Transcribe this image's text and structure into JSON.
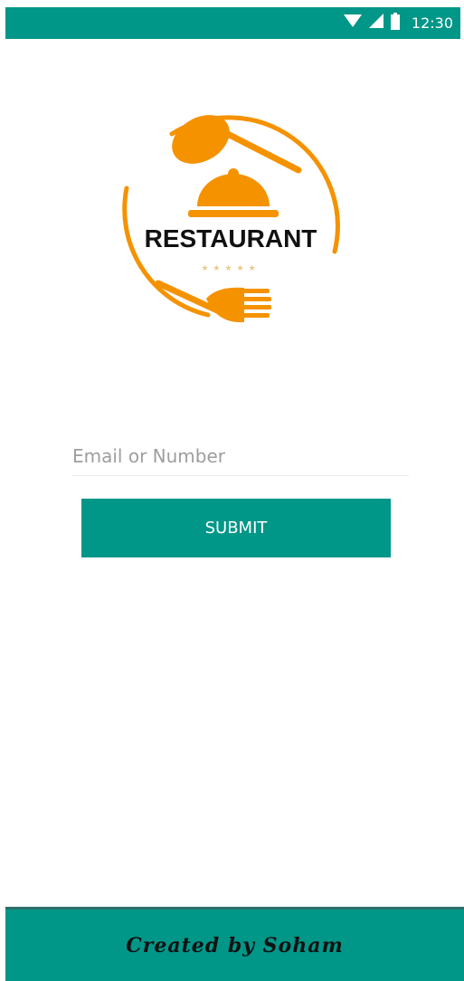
{
  "status_bar": {
    "time": "12:30",
    "icons": [
      "wifi-icon",
      "signal-icon",
      "battery-icon"
    ],
    "color": "#009688"
  },
  "logo": {
    "text": "RESTAURANT",
    "stars": "★★★★★",
    "accent_color": "#f59200"
  },
  "form": {
    "email_placeholder": "Email or Number",
    "email_value": "",
    "submit_label": "SUBMIT",
    "button_color": "#009688"
  },
  "footer": {
    "text": "Created by Soham",
    "color": "#009688"
  }
}
